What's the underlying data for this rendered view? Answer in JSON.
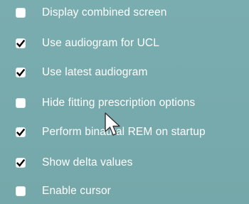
{
  "options": [
    {
      "label": "Display combined screen",
      "checked": false
    },
    {
      "label": "Use audiogram for UCL",
      "checked": true
    },
    {
      "label": "Use latest audiogram",
      "checked": true
    },
    {
      "label": "Hide fitting prescription options",
      "checked": false
    },
    {
      "label": "Perform binaural REM on startup",
      "checked": true
    },
    {
      "label": "Show delta values",
      "checked": true
    },
    {
      "label": "Enable cursor",
      "checked": false
    }
  ],
  "colors": {
    "background": "#77a9ab",
    "text": "#ffffff",
    "checkbox": "#ffffff",
    "checkmark": "#000000"
  },
  "icons": {
    "checkmark": "checkmark-icon",
    "cursor": "mouse-pointer-icon"
  }
}
